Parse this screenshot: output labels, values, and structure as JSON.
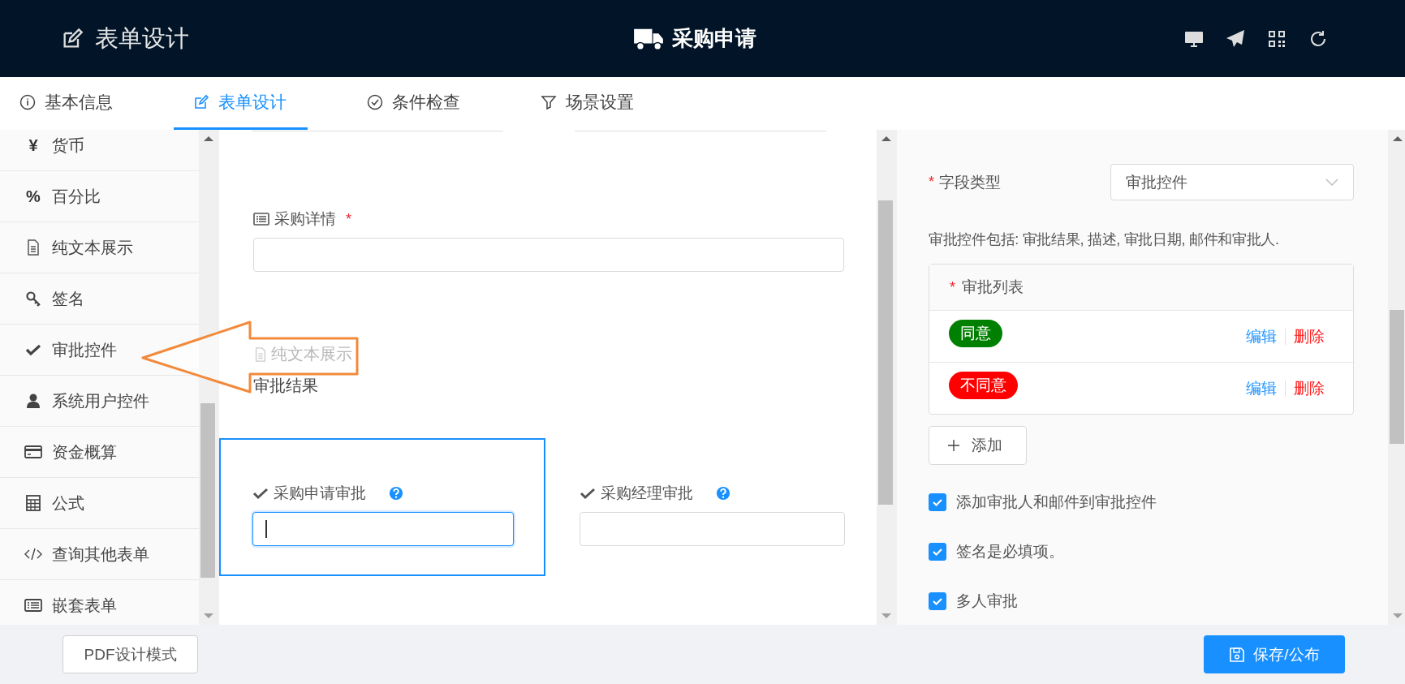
{
  "header": {
    "title": "表单设计",
    "form_name": "采购申请"
  },
  "tabs": [
    {
      "label": "基本信息",
      "selected": false
    },
    {
      "label": "表单设计",
      "selected": true
    },
    {
      "label": "条件检查",
      "selected": false
    },
    {
      "label": "场景设置",
      "selected": false
    }
  ],
  "sidebar": {
    "items": [
      {
        "label": "货币",
        "icon": "¥"
      },
      {
        "label": "百分比",
        "icon": "%"
      },
      {
        "label": "纯文本展示"
      },
      {
        "label": "签名"
      },
      {
        "label": "审批控件"
      },
      {
        "label": "系统用户控件"
      },
      {
        "label": "资金概算"
      },
      {
        "label": "公式"
      },
      {
        "label": "查询其他表单"
      },
      {
        "label": "嵌套表单"
      }
    ]
  },
  "canvas": {
    "detail_field": {
      "label": "采购详情",
      "required_mark": "*"
    },
    "drag_ghost": {
      "label": "纯文本展示"
    },
    "text_display": "审批结果",
    "approval_fields": [
      {
        "label": "采购申请审批",
        "selected": true,
        "focused": true
      },
      {
        "label": "采购经理审批",
        "selected": false,
        "focused": false
      }
    ]
  },
  "properties": {
    "field_type": {
      "label": "字段类型",
      "required_mark": "*",
      "value": "审批控件"
    },
    "description": "审批控件包括: 审批结果, 描述, 审批日期, 邮件和审批人.",
    "approval_list": {
      "title": "审批列表",
      "required_mark": "*",
      "items": [
        {
          "label": "同意",
          "color": "#008000",
          "edit": "编辑",
          "delete": "删除"
        },
        {
          "label": "不同意",
          "color": "#ff0000",
          "edit": "编辑",
          "delete": "删除"
        }
      ]
    },
    "add_button": "添加",
    "options": [
      {
        "label": "添加审批人和邮件到审批控件",
        "checked": true
      },
      {
        "label": "签名是必填项。",
        "checked": true
      },
      {
        "label": "多人审批",
        "checked": true
      }
    ]
  },
  "footer": {
    "pdf_button": "PDF设计模式",
    "save_button": "保存/公布"
  }
}
